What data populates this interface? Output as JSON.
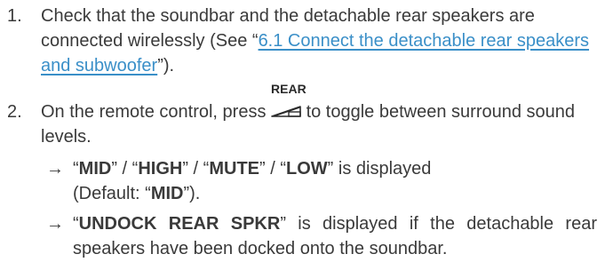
{
  "steps": [
    {
      "number": "1.",
      "text_before": "Check that the soundbar and the detachable rear speakers are connected wirelessly (See “",
      "link_text": "6.1 Connect the detachable rear speakers and subwoofer",
      "text_after": "”)."
    },
    {
      "number": "2.",
      "text_before": "On the remote control, press ",
      "key_label": "REAR",
      "text_after": " to toggle between surround sound levels."
    }
  ],
  "results": [
    {
      "arrow": "→",
      "q1": "“",
      "mid": "MID",
      "sep1": "” / “",
      "high": "HIGH",
      "sep2": "” / “",
      "mute": "MUTE",
      "sep3": "” / “",
      "low": "LOW",
      "after_low": "” is displayed",
      "default_prefix": "(Default: “",
      "default_value": "MID",
      "default_suffix": "”)."
    },
    {
      "arrow": "→",
      "q1": "“",
      "message": "UNDOCK REAR SPKR",
      "rest": "” is displayed if the detachable rear speakers have been docked onto the soundbar."
    }
  ],
  "colors": {
    "text": "#3a3a3a",
    "link": "#3a8fc8"
  },
  "icons": {
    "rear_key": "rear-speaker-wedge-icon",
    "arrow": "right-arrow-icon"
  }
}
